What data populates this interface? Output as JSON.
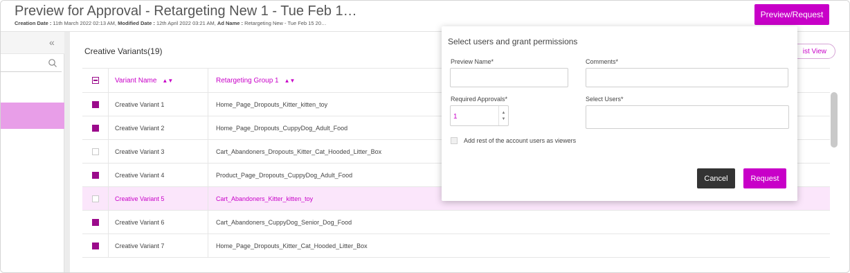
{
  "header": {
    "title": "Preview for Approval - Retargeting New 1 - Tue Feb 1…",
    "creation_label": "Creation Date :",
    "creation_value": " 11th March 2022 02:13 AM, ",
    "modified_label": "Modified Date :",
    "modified_value": " 12th April 2022 03:21 AM, ",
    "adname_label": "Ad Name :",
    "adname_value": " Retargeting New - Tue Feb 15 20…",
    "preview_request_label": "Preview/Request"
  },
  "sidebar": {
    "collapse_icon": "double-chevron-left-icon",
    "search_icon": "search-icon"
  },
  "main": {
    "variants_title": "Creative Variants(19)",
    "list_view_label": "ist View",
    "columns": [
      "Variant Name",
      "Retargeting Group 1"
    ],
    "rows": [
      {
        "name": "Creative Variant 1",
        "group": "Home_Page_Dropouts_Kitter_kitten_toy",
        "checked": true,
        "highlight": false
      },
      {
        "name": "Creative Variant 2",
        "group": "Home_Page_Dropouts_CuppyDog_Adult_Food",
        "checked": true,
        "highlight": false
      },
      {
        "name": "Creative Variant 3",
        "group": "Cart_Abandoners_Dropouts_Kitter_Cat_Hooded_Litter_Box",
        "checked": false,
        "highlight": false
      },
      {
        "name": "Creative Variant 4",
        "group": "Product_Page_Dropouts_CuppyDog_Adult_Food",
        "checked": true,
        "highlight": false
      },
      {
        "name": "Creative Variant 5",
        "group": "Cart_Abandoners_Kitter_kitten_toy",
        "checked": false,
        "highlight": true
      },
      {
        "name": "Creative Variant 6",
        "group": "Cart_Abandoners_CuppyDog_Senior_Dog_Food",
        "checked": true,
        "highlight": false
      },
      {
        "name": "Creative Variant 7",
        "group": "Home_Page_Dropouts_Kitter_Cat_Hooded_Litter_Box",
        "checked": true,
        "highlight": false
      }
    ]
  },
  "popup": {
    "title": "Select users and grant permissions",
    "preview_name_label": "Preview Name*",
    "preview_name_value": "",
    "comments_label": "Comments*",
    "comments_value": "",
    "required_approvals_label": "Required Approvals*",
    "required_approvals_value": "1",
    "select_users_label": "Select Users*",
    "add_viewers_label": "Add rest of the account users as viewers",
    "cancel_label": "Cancel",
    "request_label": "Request"
  },
  "colors": {
    "accent": "#c800c8",
    "checked": "#9b0a8b",
    "highlight_row": "#fbe6fb",
    "sidebar_selected": "#e89ee8"
  }
}
